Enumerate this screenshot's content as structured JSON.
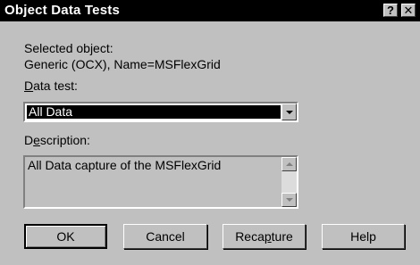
{
  "window": {
    "title": "Object Data Tests",
    "help_button": "?",
    "close_button": "✕"
  },
  "selected_object": {
    "label": "Selected object:",
    "value": "Generic (OCX), Name=MSFlexGrid"
  },
  "data_test": {
    "label_underlined": "D",
    "label_rest": "ata test:",
    "selected": "All Data"
  },
  "description": {
    "label_pre": "D",
    "label_underlined": "e",
    "label_post": "scription:",
    "text": "All Data capture of the MSFlexGrid"
  },
  "buttons": {
    "ok": "OK",
    "cancel": "Cancel",
    "recapture_pre": "Reca",
    "recapture_underlined": "p",
    "recapture_post": "ture",
    "help": "Help"
  }
}
